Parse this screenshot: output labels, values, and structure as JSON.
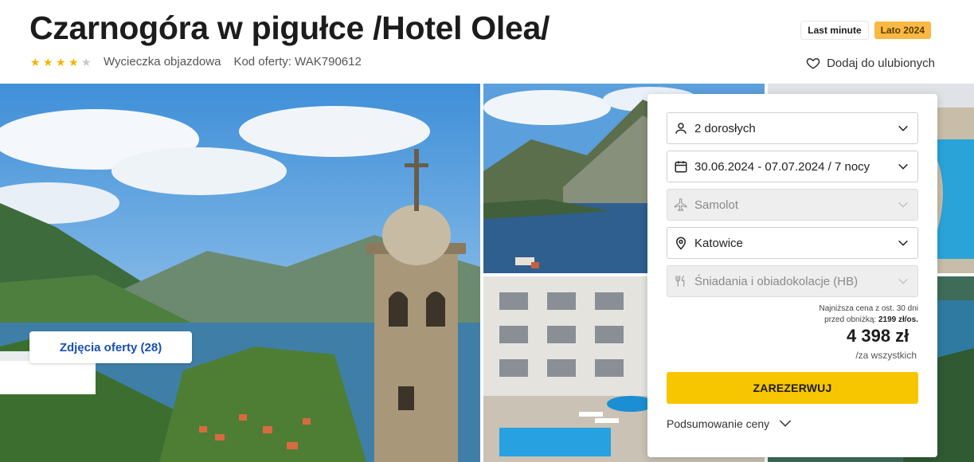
{
  "offer": {
    "title": "Czarnogóra w pigułce /Hotel Olea/",
    "rating": 4,
    "rating_max": 5,
    "trip_type": "Wycieczka objazdowa",
    "offer_code": "Kod oferty: WAK790612",
    "badges": [
      "Last minute",
      "Lato 2024"
    ],
    "favorite_label": "Dodaj do ulubionych",
    "photos_button": "Zdjęcia oferty (28)"
  },
  "booking": {
    "travelers": "2 dorosłych",
    "dates": "30.06.2024 - 07.07.2024 / 7 nocy",
    "transport": "Samolot",
    "departure": "Katowice",
    "board": "Śniadania i obiadokolacje (HB)",
    "lowest_price_line1": "Najniższa cena z ost. 30 dni",
    "lowest_price_line2": "przed obniżką:",
    "lowest_price_value": "2199 zł/os.",
    "price": "4 398 zł",
    "price_per": "/za wszystkich",
    "book_button": "ZAREZERWUJ",
    "summary_label": "Podsumowanie ceny"
  },
  "colors": {
    "accent_yellow": "#f7c600",
    "season_badge": "#f8b944",
    "link_blue": "#1a4fb5",
    "star": "#f5b400"
  }
}
